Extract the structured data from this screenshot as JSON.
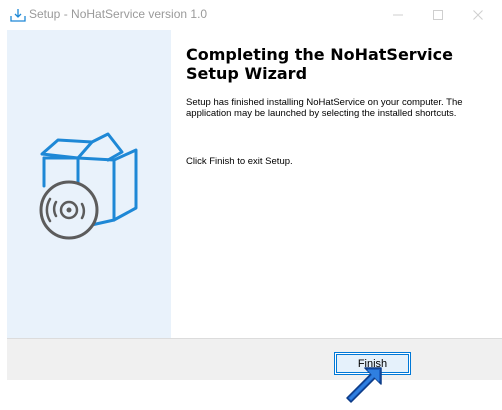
{
  "window": {
    "title": "Setup - NoHatService version 1.0",
    "icons": {
      "app": "setup-installer-icon",
      "minimize": "minimize-icon",
      "maximize": "maximize-icon",
      "close": "close-icon"
    },
    "title_color": "#9a9a9a"
  },
  "side_panel": {
    "graphic": "box-with-disc-icon",
    "background_color": "#e9f2fb",
    "accent_color": "#1e88d6"
  },
  "content": {
    "heading": "Completing the NoHatService Setup Wizard",
    "paragraph_1": "Setup has finished installing NoHatService on your computer. The application may be launched by selecting the installed shortcuts.",
    "paragraph_2": "Click Finish to exit Setup."
  },
  "buttons": {
    "finish_label": "Finish",
    "focus_color": "#0078d7"
  },
  "overlay": {
    "pointer": "blue-arrow-pointer-icon",
    "pointer_color": "#1a5fc4"
  }
}
